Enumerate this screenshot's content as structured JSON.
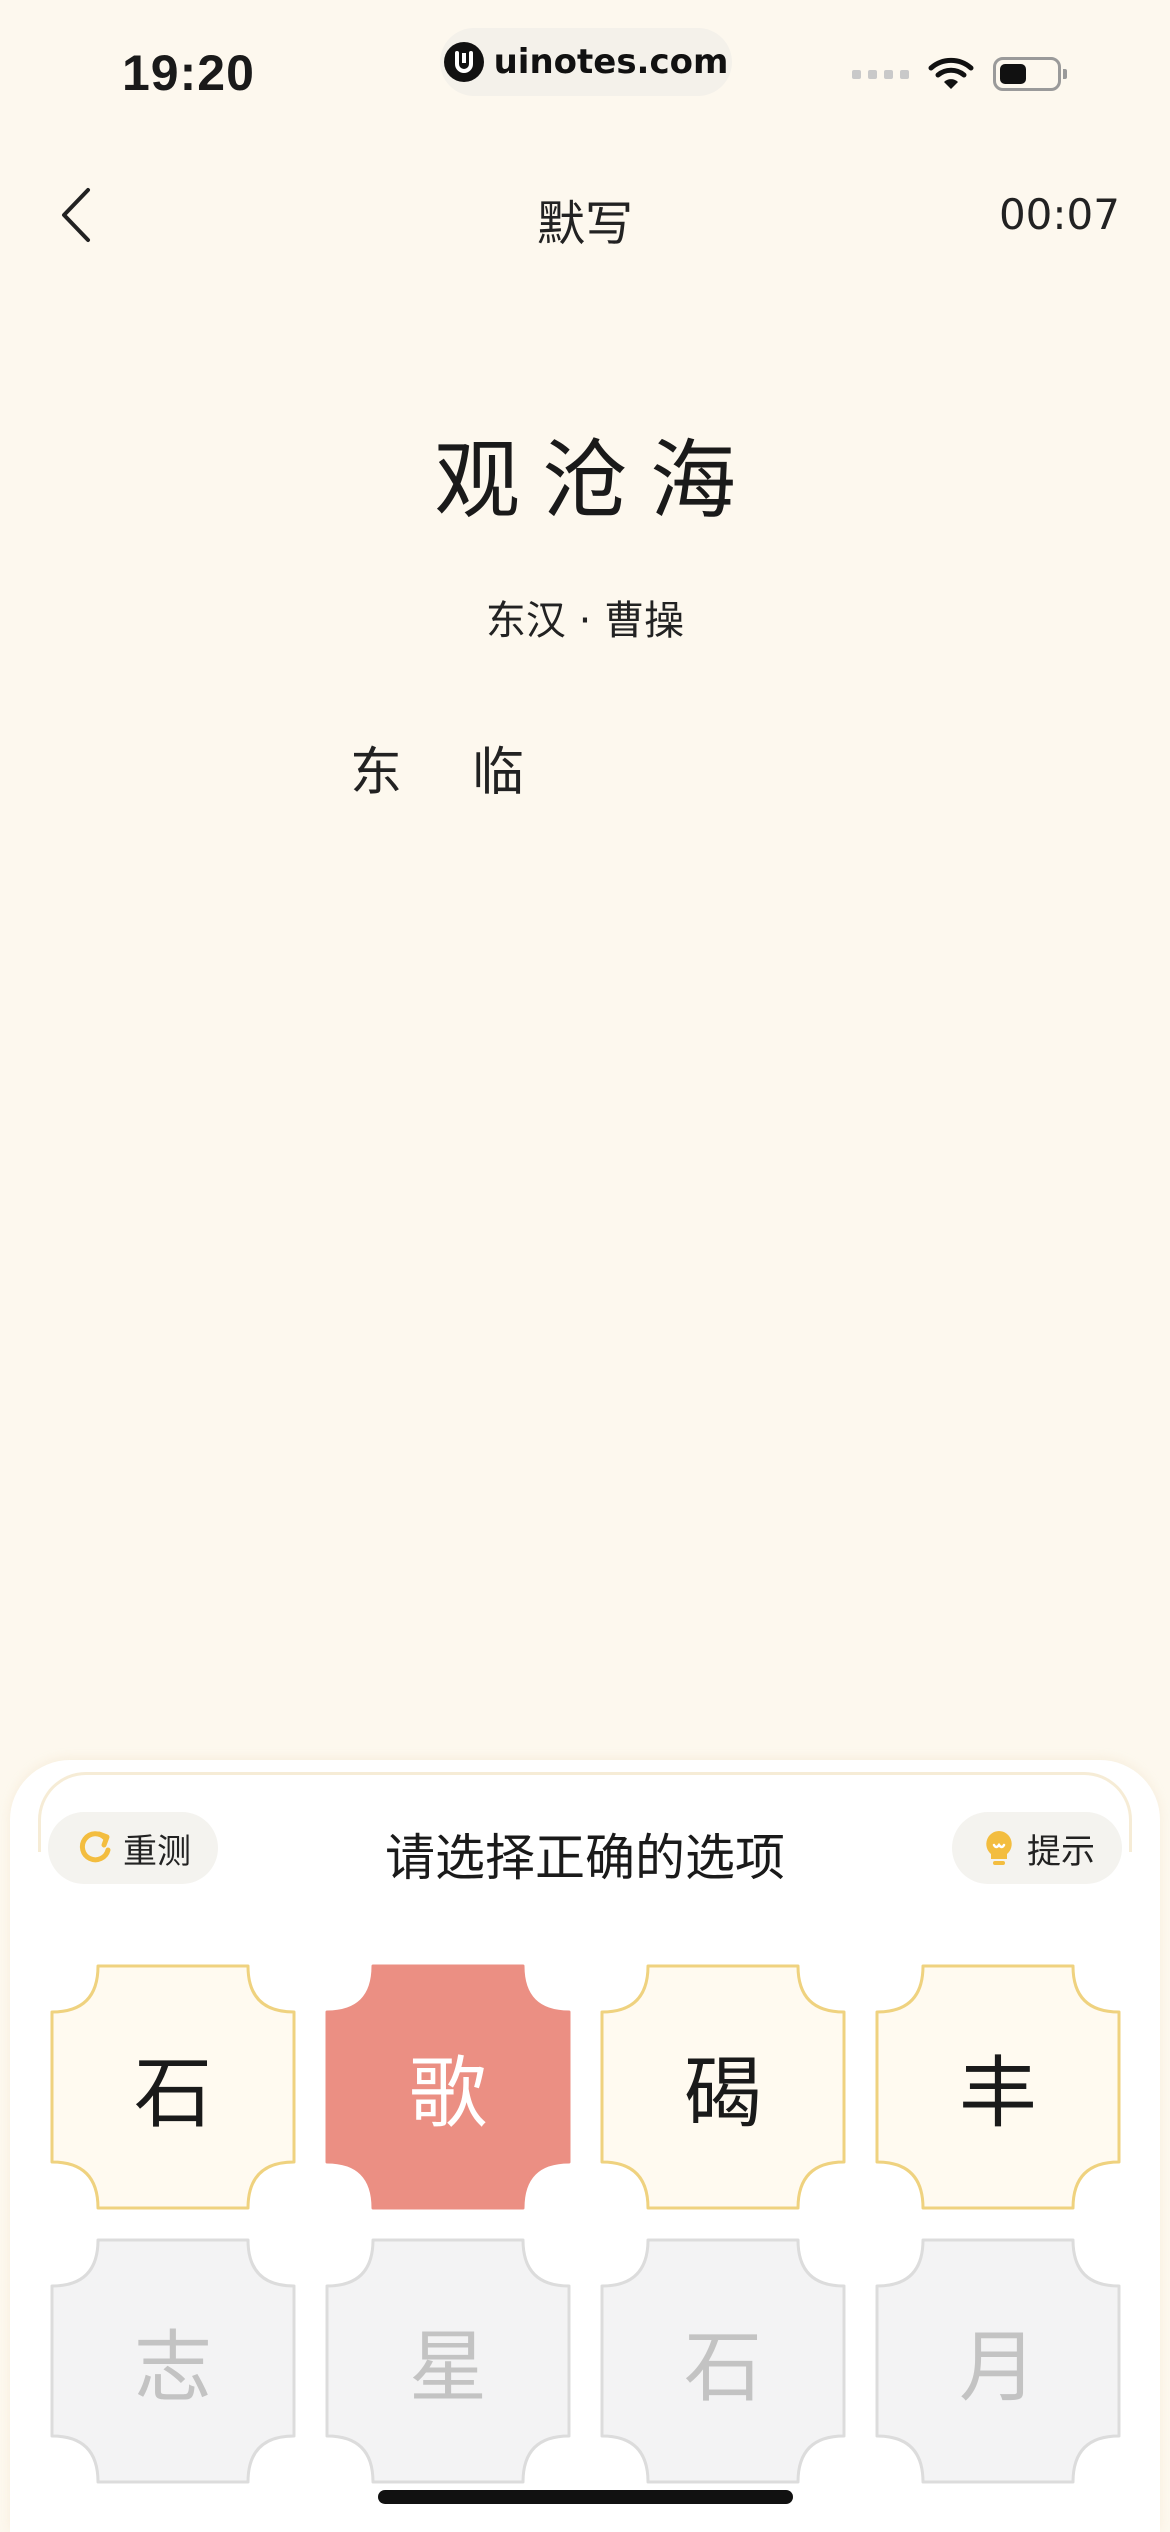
{
  "status_bar": {
    "time": "19:20",
    "url": "uinotes.com"
  },
  "nav": {
    "title": "默写",
    "timer": "00:07"
  },
  "poem": {
    "title": "观沧海",
    "author": "东汉 · 曹操",
    "typed_chars": [
      "东",
      "临"
    ]
  },
  "sheet": {
    "retest_label": "重测",
    "hint_label": "提示",
    "prompt": "请选择正确的选项"
  },
  "options": [
    {
      "char": "石",
      "state": "normal"
    },
    {
      "char": "歌",
      "state": "selected"
    },
    {
      "char": "碣",
      "state": "normal"
    },
    {
      "char": "丰",
      "state": "normal"
    },
    {
      "char": "志",
      "state": "disabled"
    },
    {
      "char": "星",
      "state": "disabled"
    },
    {
      "char": "石",
      "state": "disabled"
    },
    {
      "char": "月",
      "state": "disabled"
    }
  ],
  "colors": {
    "background": "#fdf8ee",
    "tile_normal_fill": "#fffaf0",
    "tile_normal_border": "#efd27f",
    "tile_selected_fill": "#eb8f83",
    "tile_disabled_fill": "#f3f3f4",
    "tile_disabled_border": "#dcdcdc",
    "accent_yellow": "#f3bd3f"
  },
  "icons": {
    "back": "chevron-left-icon",
    "retest": "refresh-icon",
    "hint": "lightbulb-icon"
  }
}
